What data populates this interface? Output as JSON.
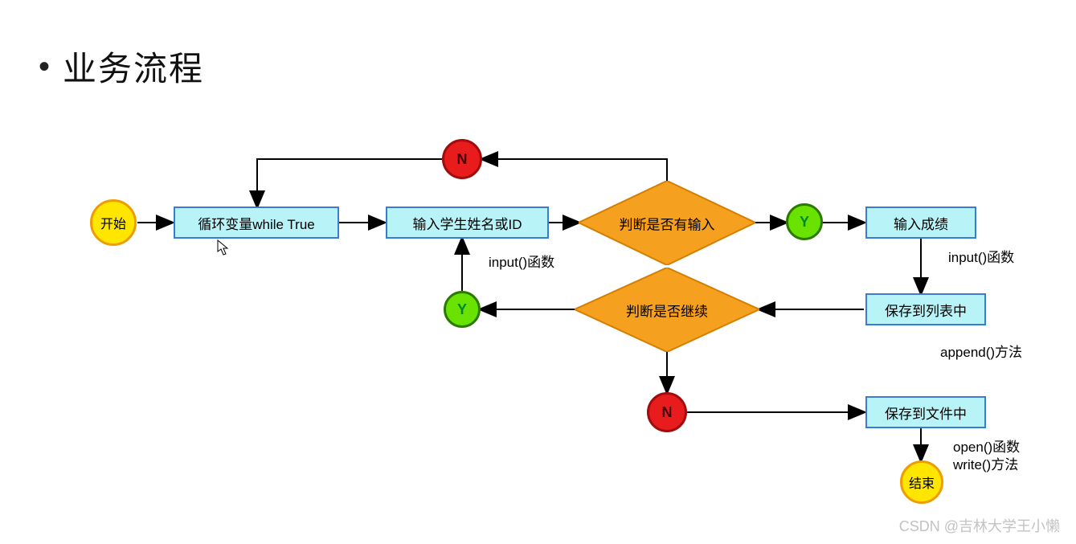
{
  "title": "业务流程",
  "nodes": {
    "start": "开始",
    "loop": "循环变量while True",
    "input_student": "输入学生姓名或ID",
    "decision_has_input": "判断是否有输入",
    "input_score": "输入成绩",
    "save_list": "保存到列表中",
    "decision_continue": "判断是否继续",
    "save_file": "保存到文件中",
    "end": "结束"
  },
  "connectors": {
    "N": "N",
    "Y": "Y"
  },
  "captions": {
    "input_fn_1": "input()函数",
    "input_fn_2": "input()函数",
    "append_method": "append()方法",
    "open_fn": "open()函数",
    "write_method": "write()方法"
  },
  "watermark": "CSDN @吉林大学王小懒",
  "colors": {
    "terminal_fill": "#ffe600",
    "terminal_stroke": "#ef9c00",
    "process_fill": "#b7f3f7",
    "process_stroke": "#3a7bd5",
    "diamond_fill": "#f6a01f",
    "diamond_stroke": "#d57f00",
    "connector_green_fill": "#6ae200",
    "connector_green_stroke": "#2b7a00",
    "connector_red_fill": "#e81c1c",
    "connector_red_stroke": "#a10c0c",
    "arrow": "#000000"
  }
}
